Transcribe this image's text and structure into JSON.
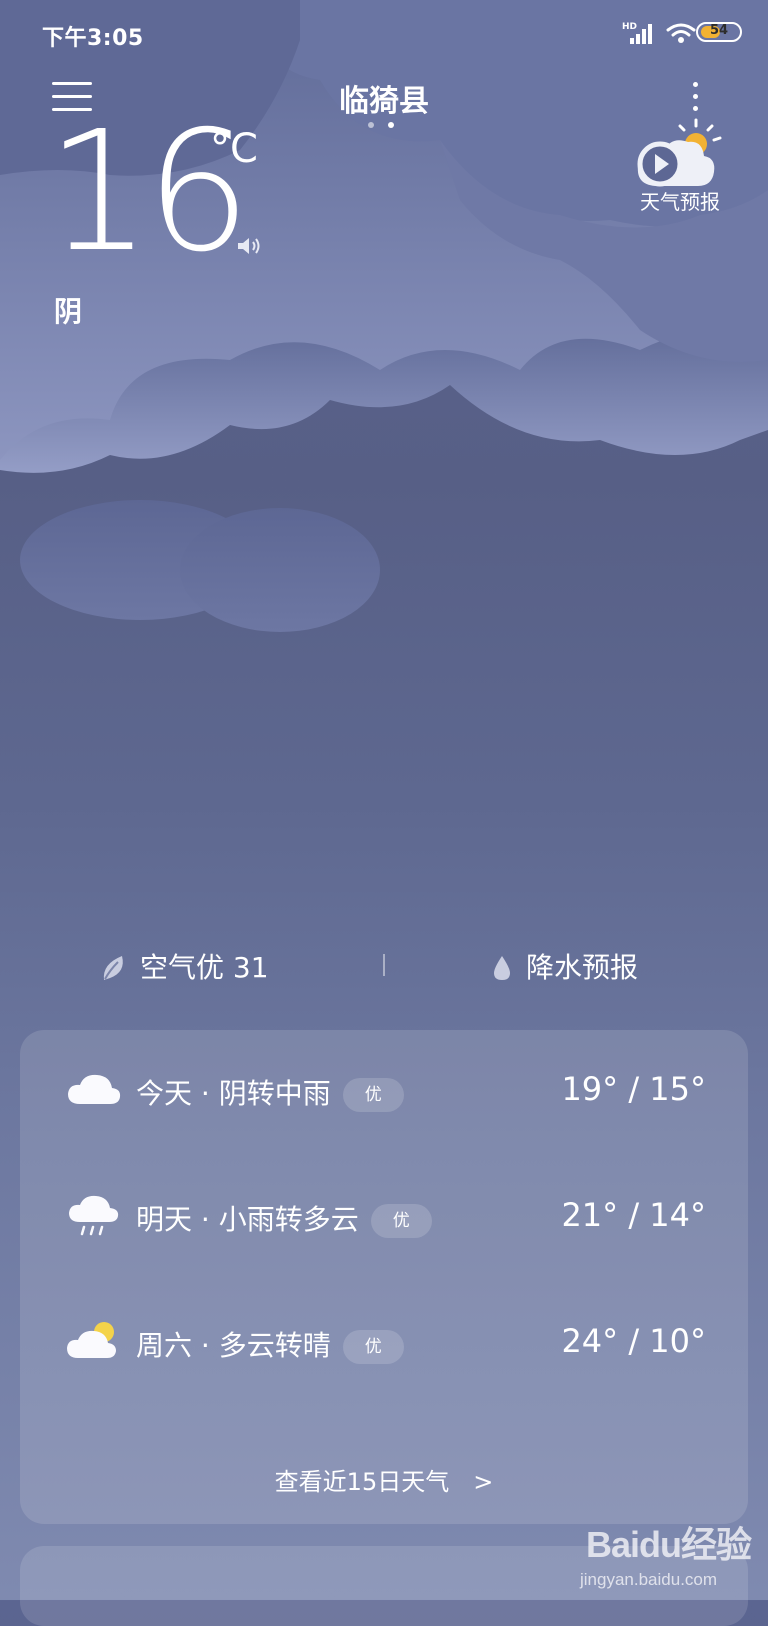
{
  "status_bar": {
    "time": "下午3:05",
    "network": "HD",
    "battery": "54",
    "battery_level": 0.54,
    "battery_color": "#f2b233"
  },
  "header": {
    "city": "临猗县",
    "menu_icon": "hamburger-menu-icon",
    "more_icon": "more-vertical-icon",
    "page_count": 2,
    "active_page": 2,
    "forecast_video_label": "天气预报",
    "forecast_video_icon": "play-cloud-sun-icon"
  },
  "current": {
    "temperature": "16",
    "unit": "°C",
    "condition": "阴",
    "speaker_icon": "speaker-icon"
  },
  "summary": {
    "aqi_label": "空气优 31",
    "aqi_icon": "leaf-icon",
    "rain_label": "降水预报",
    "rain_icon": "water-drop-icon"
  },
  "forecast": {
    "days": [
      {
        "text": "今天 · 阴转中雨",
        "badge": "优",
        "temps": "19° / 15°",
        "icon": "cloud-icon"
      },
      {
        "text": "明天 · 小雨转多云",
        "badge": "优",
        "temps": "21° / 14°",
        "icon": "cloud-rain-icon"
      },
      {
        "text": "周六 · 多云转晴",
        "badge": "优",
        "temps": "24° / 10°",
        "icon": "cloud-sun-icon"
      }
    ],
    "see_more": "查看近15日天气　>"
  },
  "watermark": {
    "logo": "Baidu经验",
    "url": "jingyan.baidu.com"
  },
  "colors": {
    "background_top": "#5b6591",
    "background_bottom": "#7f8ab0",
    "cloud": "#8b94bd",
    "card": "rgba(255,255,255,0.13)"
  }
}
